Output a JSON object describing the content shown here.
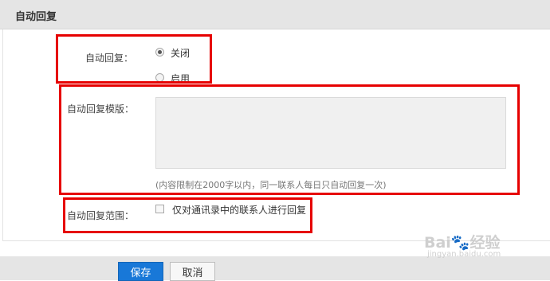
{
  "panel": {
    "title": "自动回复"
  },
  "auto_reply": {
    "label": "自动回复：",
    "options": [
      {
        "label": "关闭",
        "checked": true
      },
      {
        "label": "启用",
        "checked": false
      }
    ]
  },
  "template": {
    "label": "自动回复模版：",
    "value": "",
    "hint": "(内容限制在2000字以内，同一联系人每日只自动回复一次)"
  },
  "scope": {
    "label": "自动回复范围：",
    "checkbox_label": "仅对通讯录中的联系人进行回复",
    "checked": false
  },
  "actions": {
    "save_label": "保存",
    "cancel_label": "取消"
  },
  "watermark": {
    "main": "Bai🐾经验",
    "sub": "jingyan.baidu.com"
  },
  "colors": {
    "annotation_red": "#e60000",
    "primary_blue": "#1878d8"
  }
}
